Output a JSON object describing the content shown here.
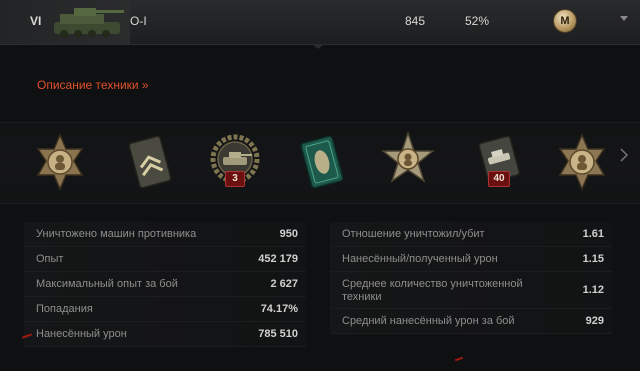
{
  "vehicle": {
    "tier": "VI",
    "name": "O-I",
    "battles": "845",
    "win_rate": "52%",
    "mastery_badge": "M",
    "tank_icon": "tank-icon"
  },
  "description_link": "Описание техники »",
  "medals": [
    {
      "name": "cross-medal-1",
      "icon": "cross-medal-icon"
    },
    {
      "name": "rank-chevron-medal",
      "icon": "chevron-badge-icon"
    },
    {
      "name": "tank-wreath-medal",
      "icon": "tank-wreath-icon",
      "count": "3"
    },
    {
      "name": "green-shell-medal",
      "icon": "shell-badge-icon"
    },
    {
      "name": "star-portrait-medal",
      "icon": "star-medal-icon"
    },
    {
      "name": "tank-badge-medal",
      "icon": "tank-badge-icon",
      "count": "40"
    },
    {
      "name": "cross-medal-2",
      "icon": "cross-medal-icon"
    }
  ],
  "stats_left": [
    {
      "label": "Уничтожено машин противника",
      "value": "950"
    },
    {
      "label": "Опыт",
      "value": "452 179"
    },
    {
      "label": "Максимальный опыт за бой",
      "value": "2 627"
    },
    {
      "label": "Попадания",
      "value": "74.17%"
    },
    {
      "label": "Нанесённый урон",
      "value": "785 510"
    }
  ],
  "stats_right": [
    {
      "label": "Отношение уничтожил/убит",
      "value": "1.61"
    },
    {
      "label": "Нанесённый/полученный урон",
      "value": "1.15"
    },
    {
      "label": "Среднее количество уничтоженной техники",
      "value": "1.12"
    },
    {
      "label": "Средний нанесённый урон за бой",
      "value": "929"
    }
  ],
  "colors": {
    "accent_link": "#e2502c",
    "badge_bg": "#6b1010",
    "background": "#0f1011"
  }
}
